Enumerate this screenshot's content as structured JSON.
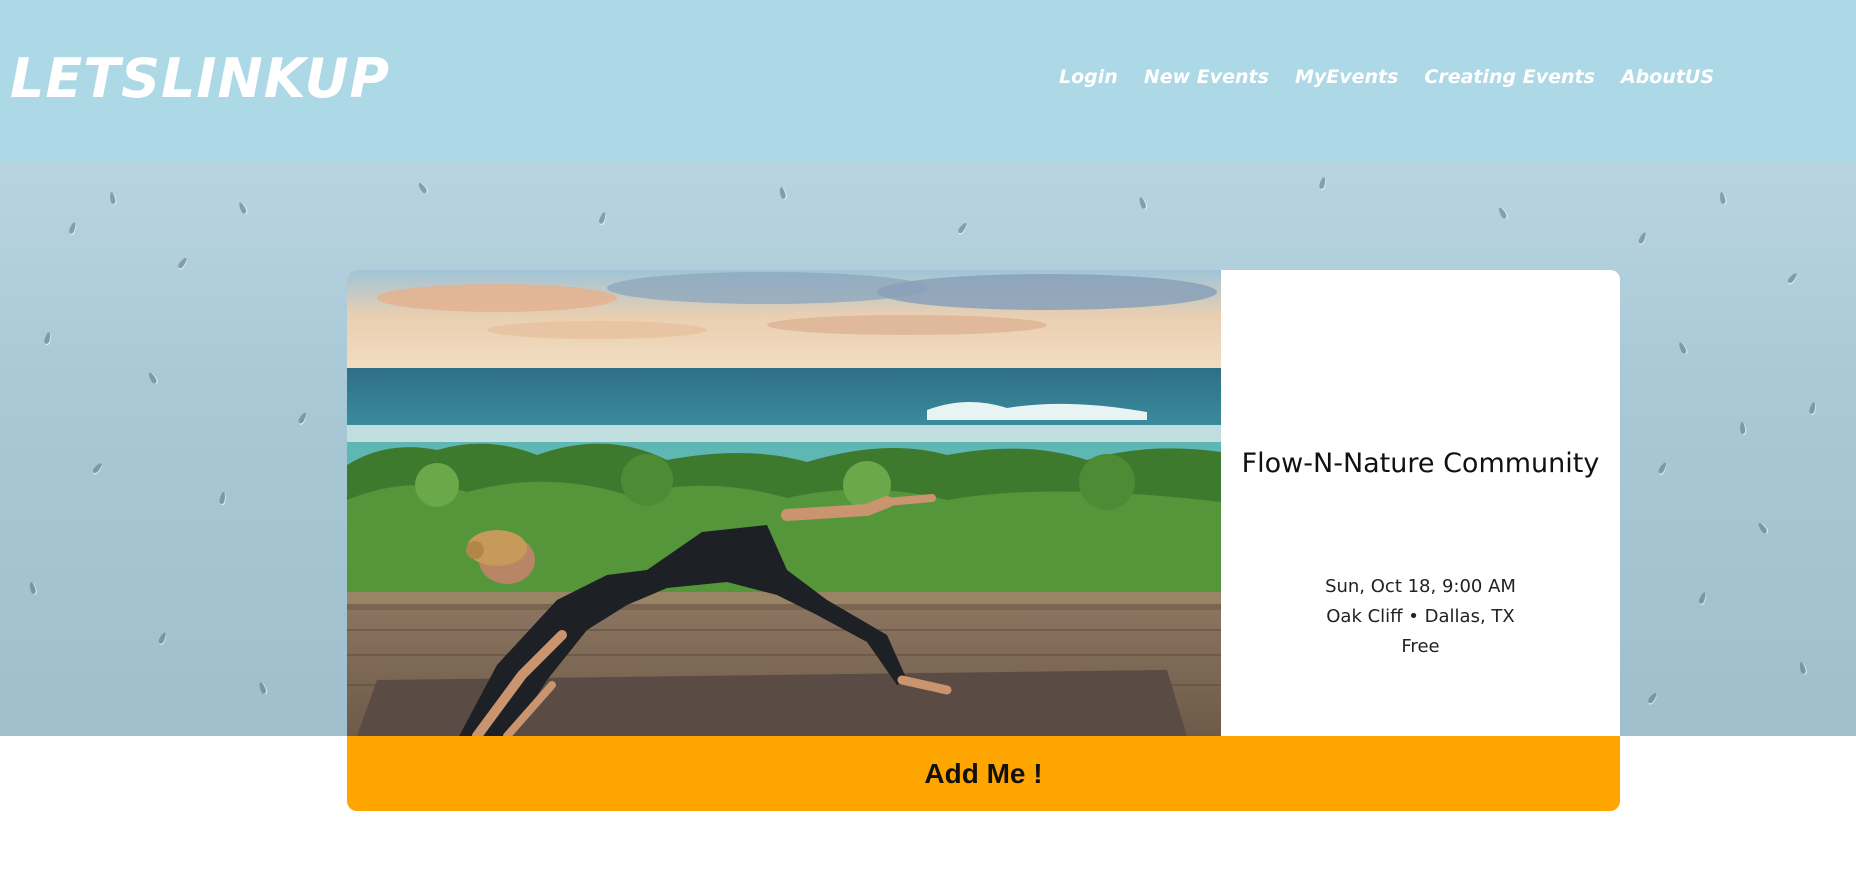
{
  "header": {
    "logo": "LETSLINKUP",
    "nav": [
      {
        "label": "Login"
      },
      {
        "label": "New Events"
      },
      {
        "label": "MyEvents"
      },
      {
        "label": "Creating Events"
      },
      {
        "label": "AboutUS"
      }
    ]
  },
  "event": {
    "image_alt": "Woman doing yoga on a deck overlooking the ocean",
    "title": "Flow-N-Nature Community",
    "datetime": "Sun, Oct 18, 9:00 AM",
    "location": "Oak Cliff • Dallas, TX",
    "price": "Free",
    "action_label": "Add Me !"
  },
  "colors": {
    "header_bg": "#add8e6",
    "button_bg": "#ffa500",
    "card_bg": "#ffffff"
  }
}
